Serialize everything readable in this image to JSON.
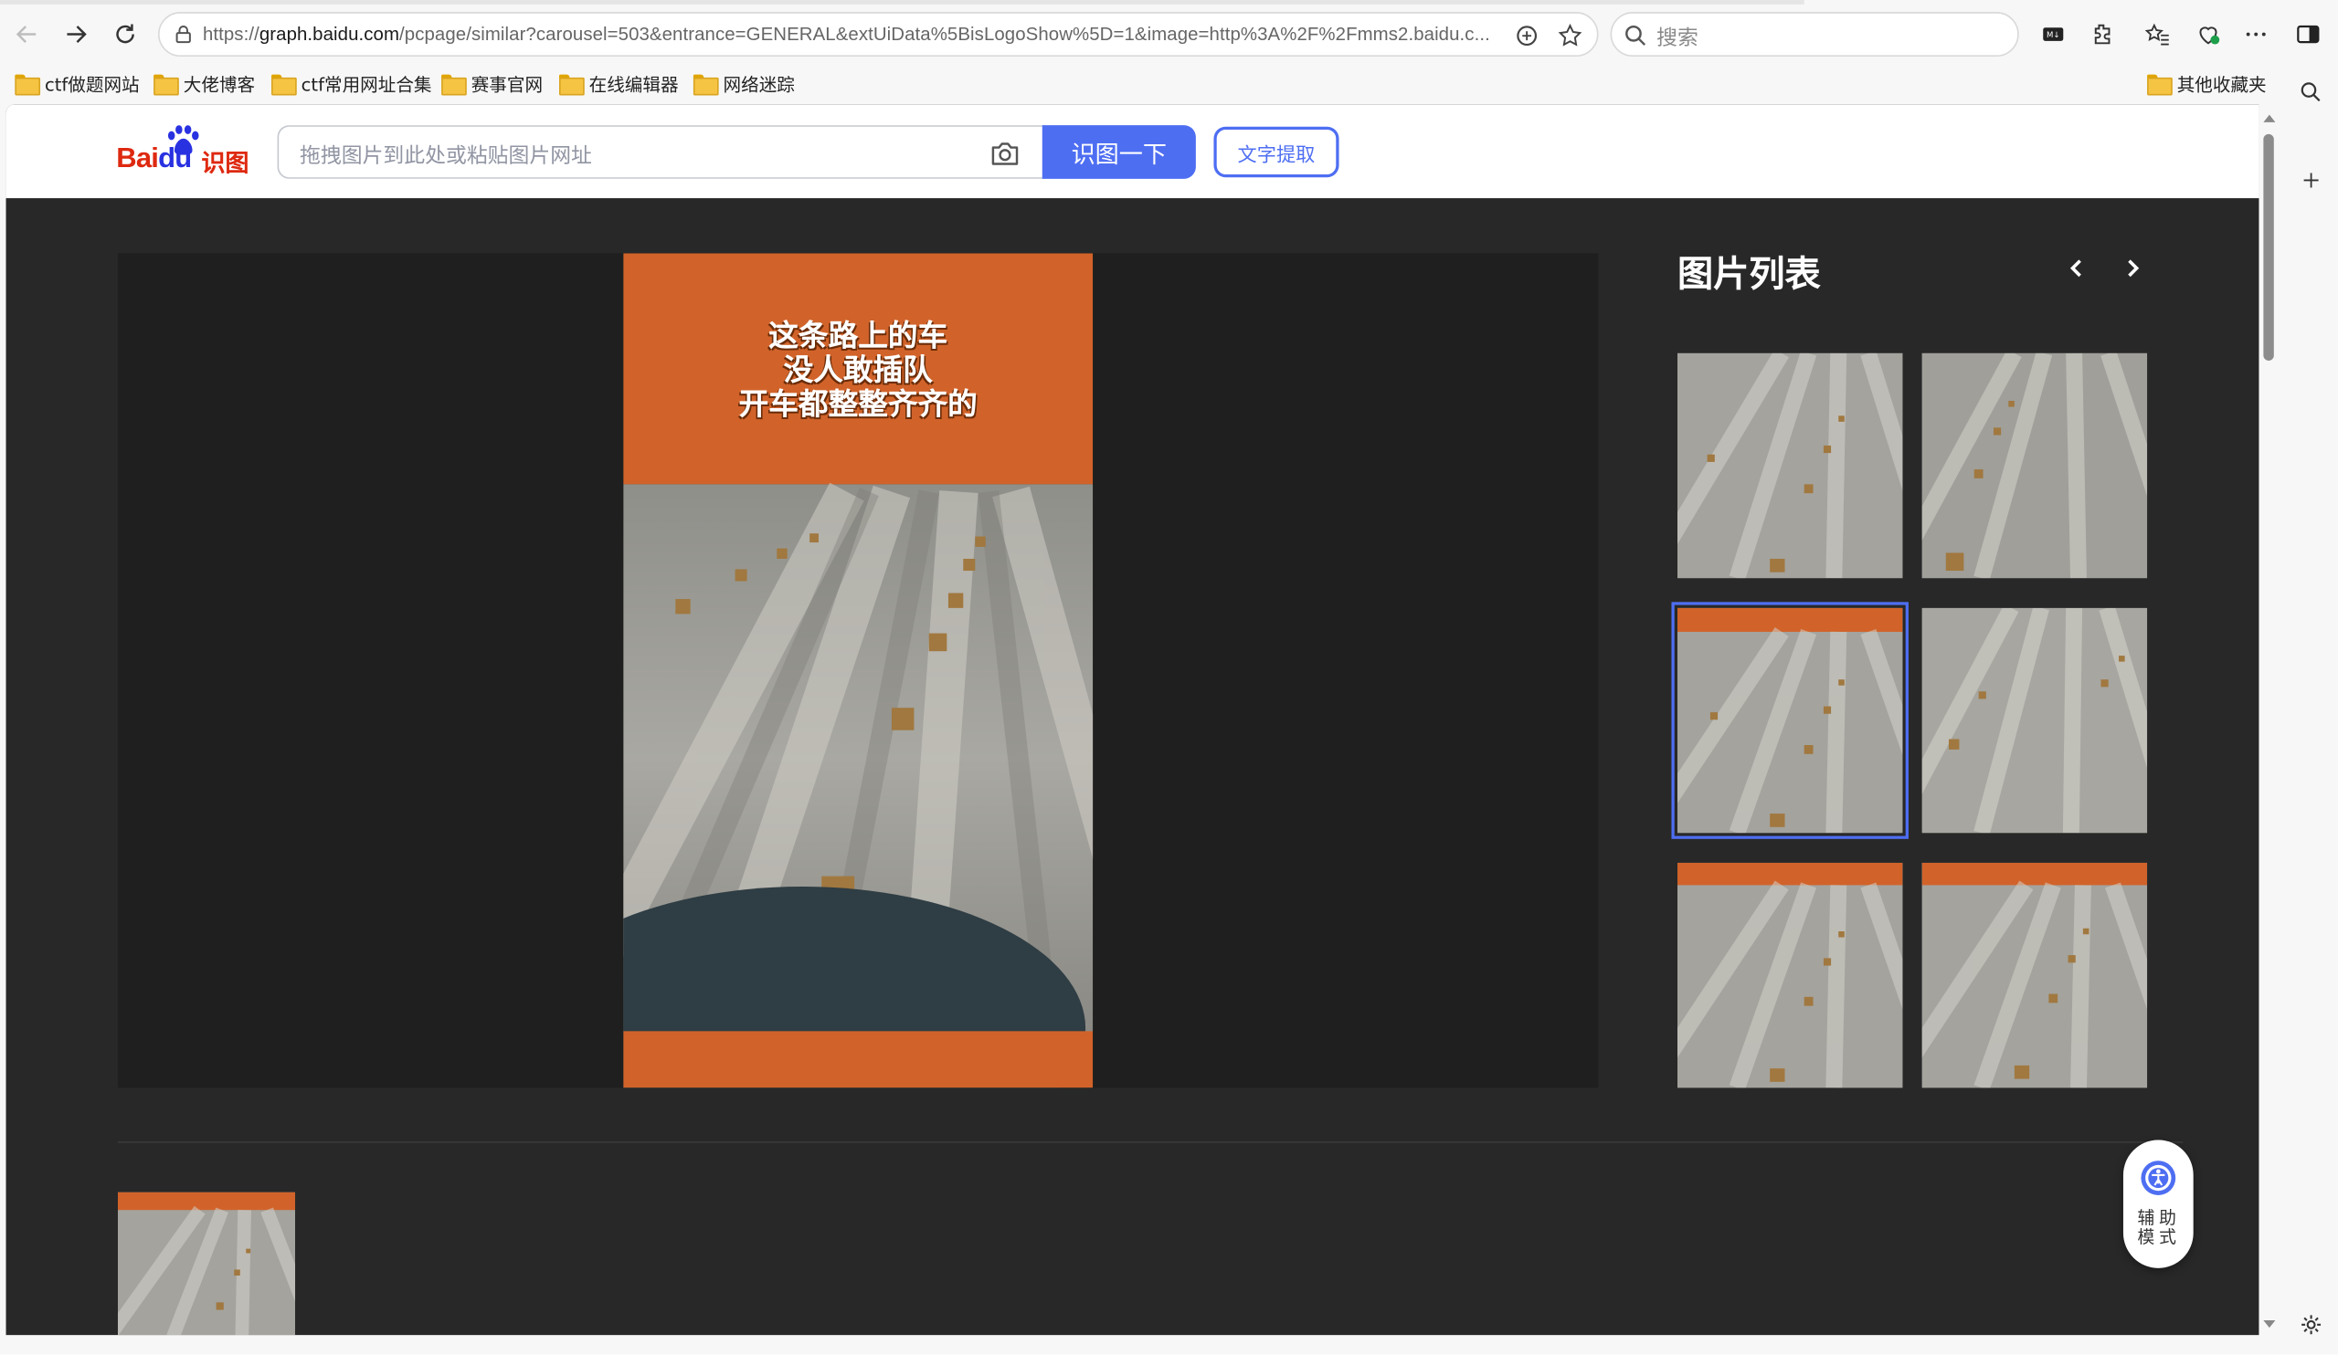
{
  "browser": {
    "url_prefix": "https://",
    "url_domain": "graph.baidu.com",
    "url_rest": "/pcpage/similar?carousel=503&entrance=GENERAL&extUiData%5BisLogoShow%5D=1&image=http%3A%2F%2Fmms2.baidu.c...",
    "search_placeholder": "搜索",
    "bookmarks": [
      "ctf做题网站",
      "大佬博客",
      "ctf常用网址合集",
      "赛事官网",
      "在线编辑器",
      "网络迷踪"
    ],
    "other_bookmarks": "其他收藏夹"
  },
  "page": {
    "logo_text_bai": "Bai",
    "logo_text_du": "du",
    "logo_sub": "识图",
    "upload_placeholder": "拖拽图片到此处或粘贴图片网址",
    "recognize_button": "识图一下",
    "text_extract_button": "文字提取",
    "image_caption_lines": [
      "这条路上的车",
      "没人敢插队",
      "开车都整整齐齐的"
    ],
    "list_title": "图片列表",
    "assist_label": "辅助模式"
  },
  "colors": {
    "accent": "#4e6ef2",
    "orange_banner": "#d4652a",
    "dark_bg": "#282828",
    "baidu_red": "#de2910",
    "baidu_blue": "#2932e1"
  },
  "thumbnails": [
    {
      "banner": false,
      "selected": false
    },
    {
      "banner": false,
      "selected": false
    },
    {
      "banner": true,
      "selected": true
    },
    {
      "banner": false,
      "selected": false
    },
    {
      "banner": true,
      "selected": false
    },
    {
      "banner": true,
      "selected": false
    }
  ]
}
